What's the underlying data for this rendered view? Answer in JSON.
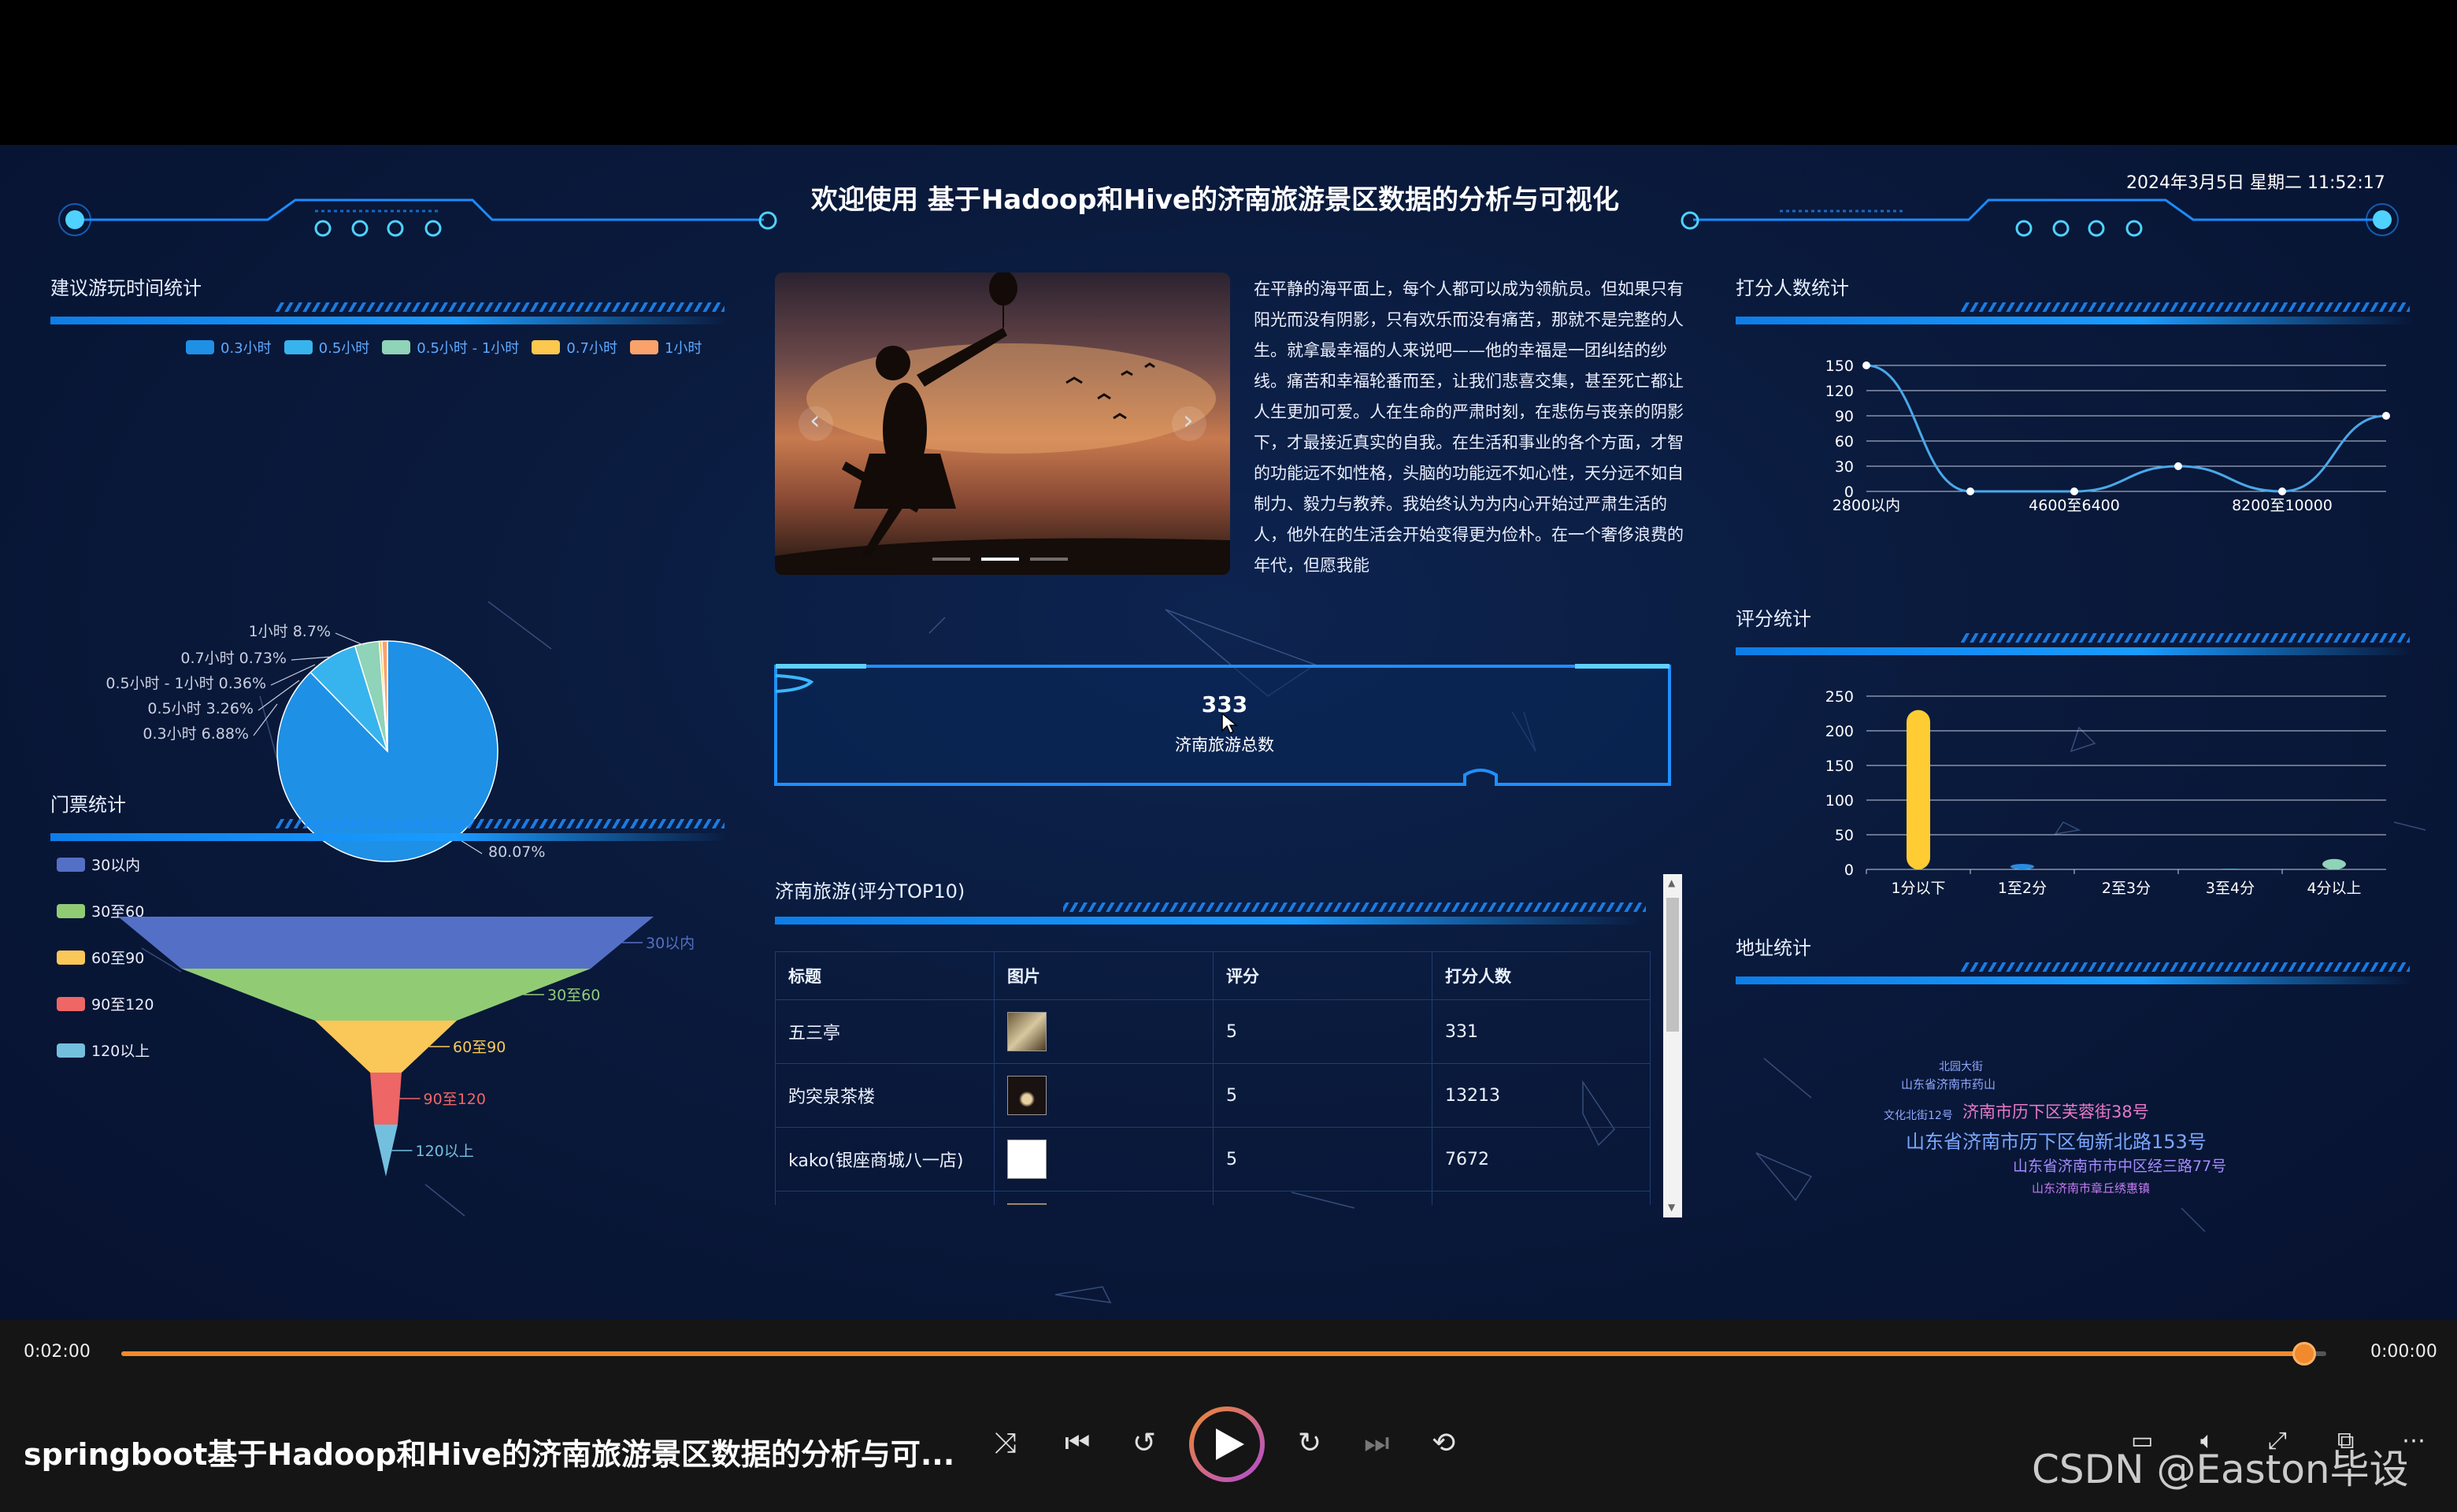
{
  "header": {
    "title": "欢迎使用 基于Hadoop和Hive的济南旅游景区数据的分析与可视化",
    "datetime": "2024年3月5日 星期二 11:52:17"
  },
  "left_top": {
    "title": "建议游玩时间统计",
    "legend": [
      {
        "label": "0.3小时",
        "color": "#1e90e6"
      },
      {
        "label": "0.5小时",
        "color": "#37b4ee"
      },
      {
        "label": "0.5小时 - 1小时",
        "color": "#8fd3b8"
      },
      {
        "label": "0.7小时",
        "color": "#fcc84e"
      },
      {
        "label": "1小时",
        "color": "#f9a26a"
      }
    ]
  },
  "left_bottom": {
    "title": "门票统计",
    "legend": [
      {
        "label": "30以内",
        "color": "#5470c6"
      },
      {
        "label": "30至60",
        "color": "#91cc75"
      },
      {
        "label": "60至90",
        "color": "#fac858"
      },
      {
        "label": "90至120",
        "color": "#ee6666"
      },
      {
        "label": "120以上",
        "color": "#73c0de"
      }
    ]
  },
  "center": {
    "carousel_text": "在平静的海平面上，每个人都可以成为领航员。但如果只有阳光而没有阴影，只有欢乐而没有痛苦，那就不是完整的人生。就拿最幸福的人来说吧——他的幸福是一团纠结的纱线。痛苦和幸福轮番而至，让我们悲喜交集，甚至死亡都让人生更加可爱。人在生命的严肃时刻，在悲伤与丧亲的阴影下，才最接近真实的自我。在生活和事业的各个方面，才智的功能远不如性格，头脑的功能远不如心性，天分远不如自制力、毅力与教养。我始终认为为内心开始过严肃生活的人，他外在的生活会开始变得更为俭朴。在一个奢侈浪费的年代，但愿我能",
    "total_value": "333",
    "total_label": "济南旅游总数",
    "prev_arrow": "‹",
    "next_arrow": "›"
  },
  "top10": {
    "title": "济南旅游(评分TOP10)",
    "headers": [
      "标题",
      "图片",
      "评分",
      "打分人数"
    ],
    "rows": [
      {
        "title": "五三亭",
        "score": "5",
        "count": "331"
      },
      {
        "title": "趵突泉茶楼",
        "score": "5",
        "count": "13213"
      },
      {
        "title": "kako(银座商城八一店)",
        "score": "5",
        "count": "7672"
      }
    ]
  },
  "right": {
    "rater_title": "打分人数统计",
    "rating_title": "评分统计",
    "address_title": "地址统计",
    "wordcloud": [
      {
        "text": "北园大街",
        "color": "#8fa8ff",
        "size": 14
      },
      {
        "text": "山东省济南市药山",
        "color": "#8fa8ff",
        "size": 15
      },
      {
        "text": "文化北街12号",
        "color": "#8fa8ff",
        "size": 14
      },
      {
        "text": "济南市历下区芙蓉街38号",
        "color": "#e57ac8",
        "size": 21
      },
      {
        "text": "山东省济南市历下区甸新北路153号",
        "color": "#7aa7ff",
        "size": 24
      },
      {
        "text": "山东省济南市市中区经三路77号",
        "color": "#a58cff",
        "size": 19
      },
      {
        "text": "山东济南市章丘绣惠镇",
        "color": "#c27cf0",
        "size": 15
      }
    ]
  },
  "chart_data": [
    {
      "type": "pie",
      "title": "建议游玩时间统计",
      "labels": [
        "0.3小时",
        "0.5小时",
        "0.5小时 - 1小时",
        "0.7小时",
        "1小时"
      ],
      "values": [
        80.07,
        6.88,
        3.26,
        0.36,
        0.73
      ],
      "colors": [
        "#1e90e6",
        "#37b4ee",
        "#8fd3b8",
        "#fcc84e",
        "#f9a26a"
      ],
      "slice_labels": [
        "80.07%",
        "0.3小时 6.88%",
        "0.5小时 3.26%",
        "0.5小时 - 1小时 0.36%",
        "0.7小时 0.73%",
        "1小时 8.7%"
      ]
    },
    {
      "type": "funnel",
      "title": "门票统计",
      "categories": [
        "30以内",
        "30至60",
        "60至90",
        "90至120",
        "120以上"
      ],
      "colors": [
        "#5470c6",
        "#91cc75",
        "#fac858",
        "#ee6666",
        "#73c0de"
      ]
    },
    {
      "type": "line",
      "title": "打分人数统计",
      "x_ticks": [
        "2800以内",
        "4600至6400",
        "8200至10000"
      ],
      "y_ticks": [
        0,
        30,
        60,
        90,
        120,
        150
      ],
      "ylim": [
        0,
        150
      ],
      "values": [
        150,
        0,
        0,
        30,
        0,
        90
      ],
      "color": "#4aa8e8",
      "grid": true
    },
    {
      "type": "bar",
      "title": "评分统计",
      "categories": [
        "1分以下",
        "1至2分",
        "2至3分",
        "3至4分",
        "4分以上"
      ],
      "values": [
        230,
        8,
        0,
        1,
        15
      ],
      "colors": [
        "#ffcc33",
        "#2a8be0",
        "#73c0de",
        "#5fb0d8",
        "#8fd3b8"
      ],
      "y_ticks": [
        0,
        50,
        100,
        150,
        200,
        250
      ],
      "ylim": [
        0,
        250
      ],
      "grid": true
    }
  ],
  "player": {
    "time_current": "0:02:00",
    "time_total": "0:00:00",
    "progress": 0.99,
    "title": "springboot基于Hadoop和Hive的济南旅游景区数据的分析与可...",
    "watermark": "CSDN @Easton毕设"
  }
}
